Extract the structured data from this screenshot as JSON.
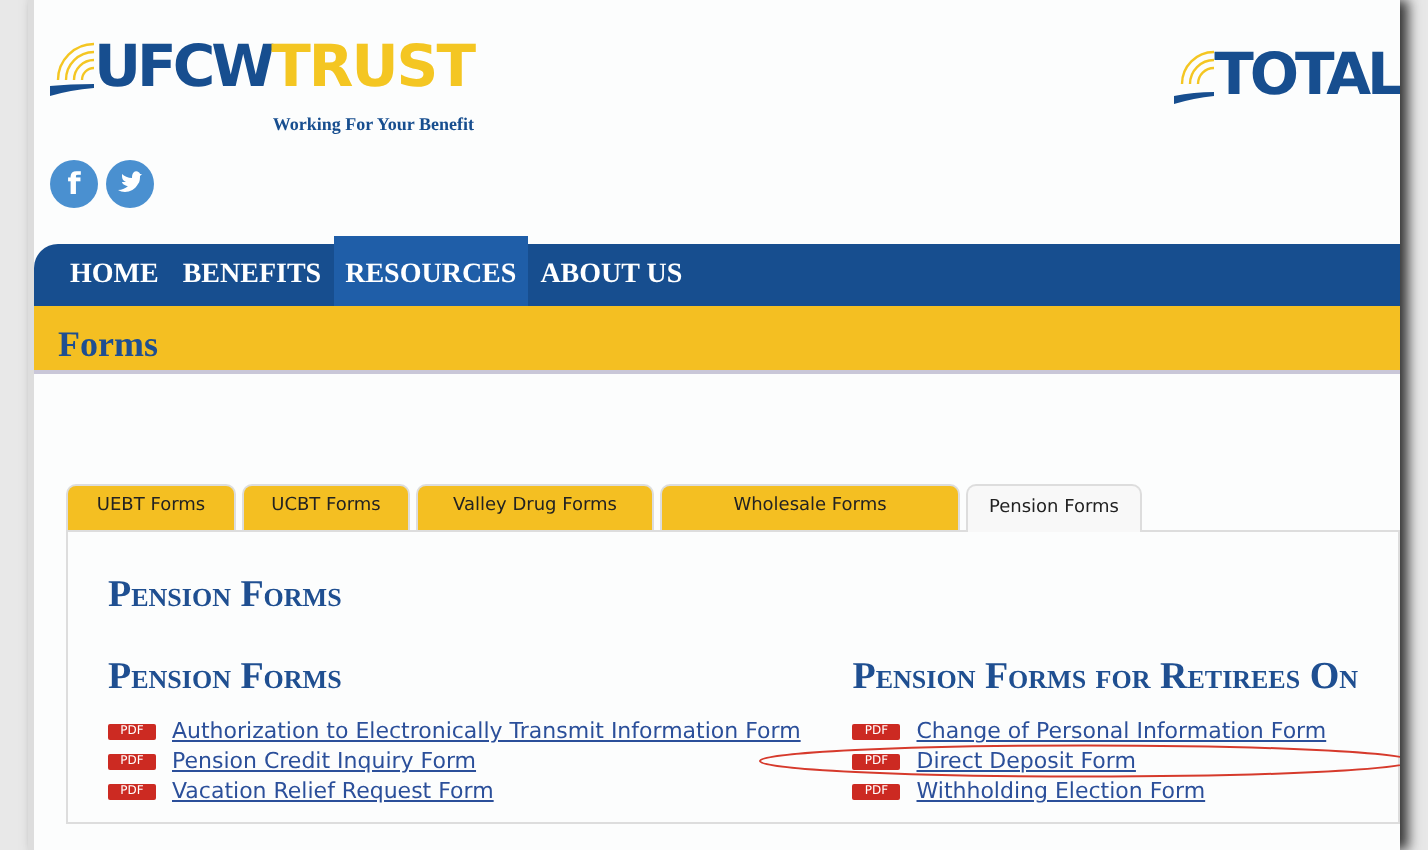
{
  "header": {
    "logo": {
      "part_1": "UFCW",
      "part_2": "TRUST",
      "tagline": "Working For Your Benefit"
    },
    "partner_logo": "TOTAL",
    "social": [
      {
        "kind": "facebook",
        "text": "f"
      },
      {
        "kind": "twitter"
      }
    ]
  },
  "nav": [
    {
      "label": "HOME",
      "selected": false
    },
    {
      "label": "BENEFITS",
      "selected": false
    },
    {
      "label": "RESOURCES",
      "selected": true
    },
    {
      "label": "ABOUT US",
      "selected": false
    }
  ],
  "page_title": "Forms",
  "tabs": [
    {
      "label": "UEBT Forms",
      "selected": false
    },
    {
      "label": "UCBT Forms",
      "selected": false
    },
    {
      "label": "Valley Drug Forms",
      "selected": false
    },
    {
      "label": "Wholesale Forms",
      "selected": false
    },
    {
      "label": "Pension Forms",
      "selected": true
    }
  ],
  "panel_title": "Pension Forms",
  "sections": [
    {
      "title": "Pension Forms",
      "links": [
        {
          "badge": "PDF",
          "label": "Authorization to Electronically Transmit Information Form",
          "circled": false
        },
        {
          "badge": "PDF",
          "label": "Pension Credit Inquiry Form",
          "circled": false
        },
        {
          "badge": "PDF",
          "label": "Vacation Relief Request Form",
          "circled": false
        }
      ]
    },
    {
      "title": "Pension Forms for Retirees On",
      "links": [
        {
          "badge": "PDF",
          "label": "Change of Personal Information Form",
          "circled": false
        },
        {
          "badge": "PDF",
          "label": "Direct Deposit Form",
          "circled": true
        },
        {
          "badge": "PDF",
          "label": "Withholding Election Form",
          "circled": false
        }
      ]
    }
  ]
}
